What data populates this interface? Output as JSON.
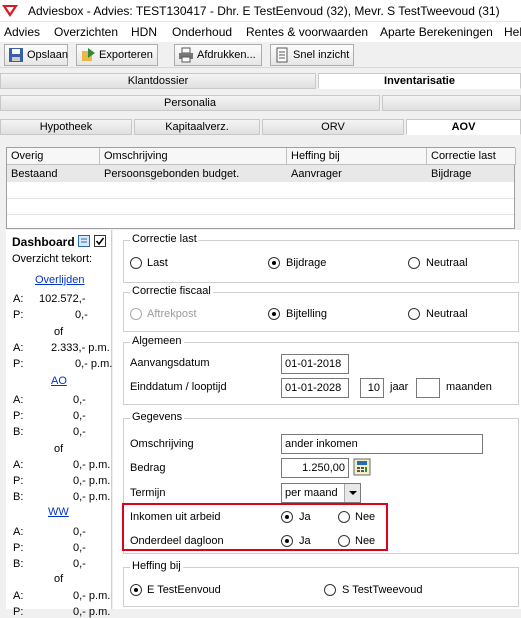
{
  "window": {
    "title": "Adviesbox - Advies: TEST130417 - Dhr. E TestEenvoud (32), Mevr. S TestTweevoud (31)"
  },
  "menu": [
    "Advies",
    "Overzichten",
    "HDN",
    "Onderhoud",
    "Rentes & voorwaarden",
    "Aparte Berekeningen",
    "Help"
  ],
  "toolbar": {
    "save": "Opslaan",
    "export": "Exporteren",
    "print": "Afdrukken...",
    "quick": "Snel inzicht"
  },
  "tabs": {
    "row1": [
      "Klantdossier",
      "Inventarisatie"
    ],
    "row2": [
      "Personalia",
      ""
    ],
    "row3": [
      "Hypotheek",
      "Kapitaalverz.",
      "ORV",
      "AOV"
    ]
  },
  "grid": {
    "headers": [
      "Overig",
      "Omschrijving",
      "Heffing bij",
      "Correctie last"
    ],
    "rows": [
      [
        "Bestaand",
        "Persoonsgebonden budget.",
        "Aanvrager",
        "Bijdrage"
      ]
    ]
  },
  "dashboard": {
    "title": "Dashboard",
    "subtitle": "Overzicht tekort:",
    "overlijden": "Overlijden",
    "ol_a_label": "A:",
    "ol_a_value": "102.572,-",
    "ol_p_label": "P:",
    "ol_p_value": "0,-",
    "of1": "of",
    "ol2_a_label": "A:",
    "ol2_a_value": "2.333,- p.m.",
    "ol2_p_label": "P:",
    "ol2_p_value": "0,- p.m.",
    "ao": "AO",
    "ao_a_label": "A:",
    "ao_a_value": "0,-",
    "ao_p_label": "P:",
    "ao_p_value": "0,-",
    "ao_b_label": "B:",
    "ao_b_value": "0,-",
    "of2": "of",
    "ao2_a_label": "A:",
    "ao2_a_value": "0,- p.m.",
    "ao2_p_label": "P:",
    "ao2_p_value": "0,- p.m.",
    "ao2_b_label": "B:",
    "ao2_b_value": "0,- p.m.",
    "ww": "WW",
    "ww_a_label": "A:",
    "ww_a_value": "0,-",
    "ww_p_label": "P:",
    "ww_p_value": "0,-",
    "ww_b_label": "B:",
    "ww_b_value": "0,-",
    "of3": "of",
    "ww2_a_label": "A:",
    "ww2_a_value": "0,- p.m.",
    "ww2_p_label": "P:",
    "ww2_p_value": "0,- p.m."
  },
  "correctie_last": {
    "title": "Correctie last",
    "opt1": "Last",
    "opt2": "Bijdrage",
    "opt3": "Neutraal"
  },
  "correctie_fiscaal": {
    "title": "Correctie fiscaal",
    "opt1": "Aftrekpost",
    "opt2": "Bijtelling",
    "opt3": "Neutraal"
  },
  "algemeen": {
    "title": "Algemeen",
    "start_label": "Aanvangsdatum",
    "start_value": "01-01-2018",
    "end_label": "Einddatum / looptijd",
    "end_value": "01-01-2028",
    "years_value": "10",
    "years_unit": "jaar",
    "months_value": "",
    "months_unit": "maanden"
  },
  "gegevens": {
    "title": "Gegevens",
    "desc_label": "Omschrijving",
    "desc_value": "ander inkomen",
    "amount_label": "Bedrag",
    "amount_value": "1.250,00",
    "term_label": "Termijn",
    "term_value": "per maand",
    "work_label": "Inkomen uit arbeid",
    "work_yes": "Ja",
    "work_no": "Nee",
    "dag_label": "Onderdeel dagloon",
    "dag_yes": "Ja",
    "dag_no": "Nee"
  },
  "heffing": {
    "title": "Heffing bij",
    "opt1": "E  TestEenvoud",
    "opt2": "S  TestTweevoud"
  }
}
